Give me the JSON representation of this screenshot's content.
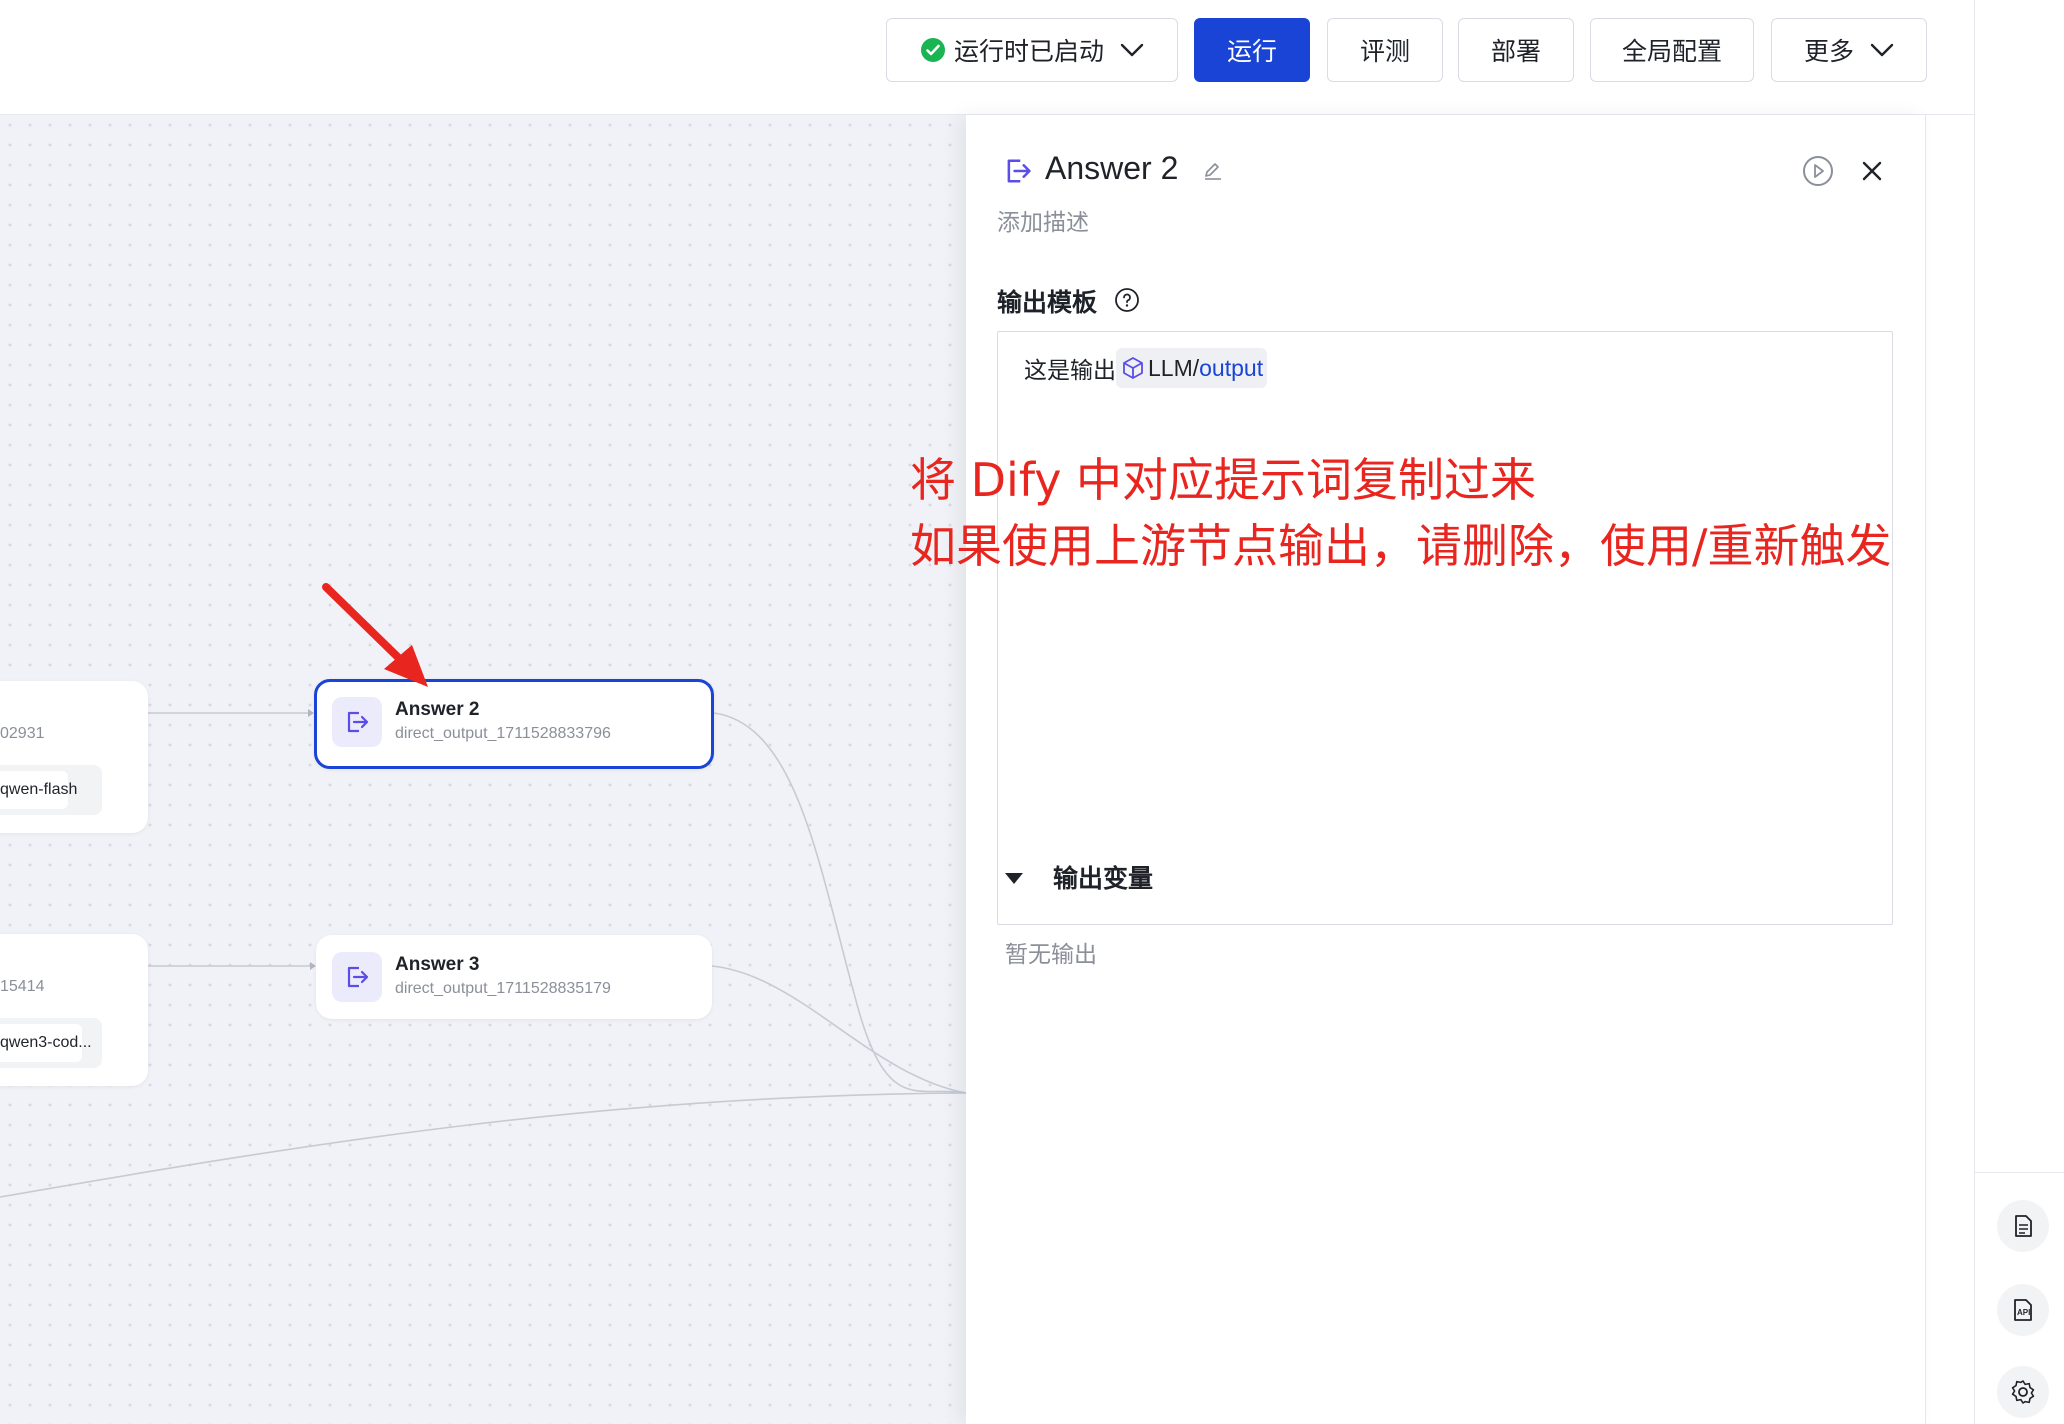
{
  "toolbar": {
    "runtime_status": "运行时已启动",
    "run": "运行",
    "evaluate": "评测",
    "deploy": "部署",
    "global_config": "全局配置",
    "more": "更多"
  },
  "canvas": {
    "node_left_1": {
      "id_tail": "02931",
      "model": "qwen-flash"
    },
    "node_left_2": {
      "id_tail": "15414",
      "model": "qwen3-cod..."
    },
    "answer2": {
      "title": "Answer 2",
      "subtitle": "direct_output_1711528833796",
      "selected": true
    },
    "answer3": {
      "title": "Answer 3",
      "subtitle": "direct_output_1711528835179"
    }
  },
  "panel": {
    "title": "Answer 2",
    "description_placeholder": "添加描述",
    "template_label": "输出模板",
    "template_text": "这是输出",
    "var_source": "LLM",
    "var_sep": "/",
    "var_name": "output",
    "output_vars_label": "输出变量",
    "no_output": "暂无输出"
  },
  "annotation": {
    "line1": "将 Dify 中对应提示词复制过来",
    "line2": "如果使用上游节点输出，请删除，使用/重新触发"
  },
  "colors": {
    "primary": "#1a44d6",
    "accent_purple": "#5b4ee6",
    "annotation_red": "#e8261f",
    "success_green": "#1bb453"
  }
}
